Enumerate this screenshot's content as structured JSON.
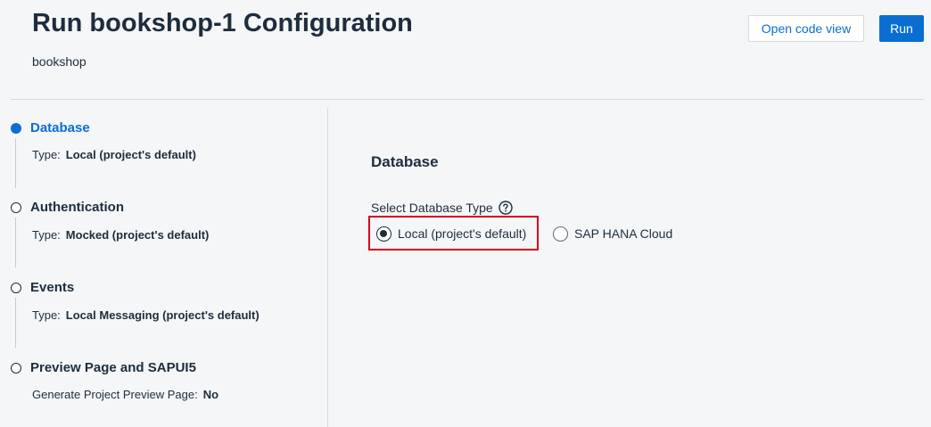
{
  "header": {
    "title": "Run bookshop-1 Configuration",
    "subtitle": "bookshop",
    "open_code_view_label": "Open code view",
    "run_label": "Run"
  },
  "sidebar": {
    "steps": [
      {
        "title": "Database",
        "detail_label": "Type:",
        "detail_value": "Local (project's default)",
        "active": true
      },
      {
        "title": "Authentication",
        "detail_label": "Type:",
        "detail_value": "Mocked (project's default)",
        "active": false
      },
      {
        "title": "Events",
        "detail_label": "Type:",
        "detail_value": "Local Messaging (project's default)",
        "active": false
      },
      {
        "title": "Preview Page and SAPUI5",
        "detail_label": "Generate Project Preview Page:",
        "detail_value": "No",
        "active": false
      }
    ]
  },
  "main": {
    "section_title": "Database",
    "field_label": "Select Database Type",
    "help_icon": "question-circle-icon",
    "options": [
      {
        "label": "Local (project's default)",
        "selected": true
      },
      {
        "label": "SAP HANA Cloud",
        "selected": false
      }
    ]
  },
  "colors": {
    "accent": "#0a6ed1",
    "text": "#1d2d3e",
    "background": "#f5f6f7",
    "highlight": "#d6001c"
  }
}
